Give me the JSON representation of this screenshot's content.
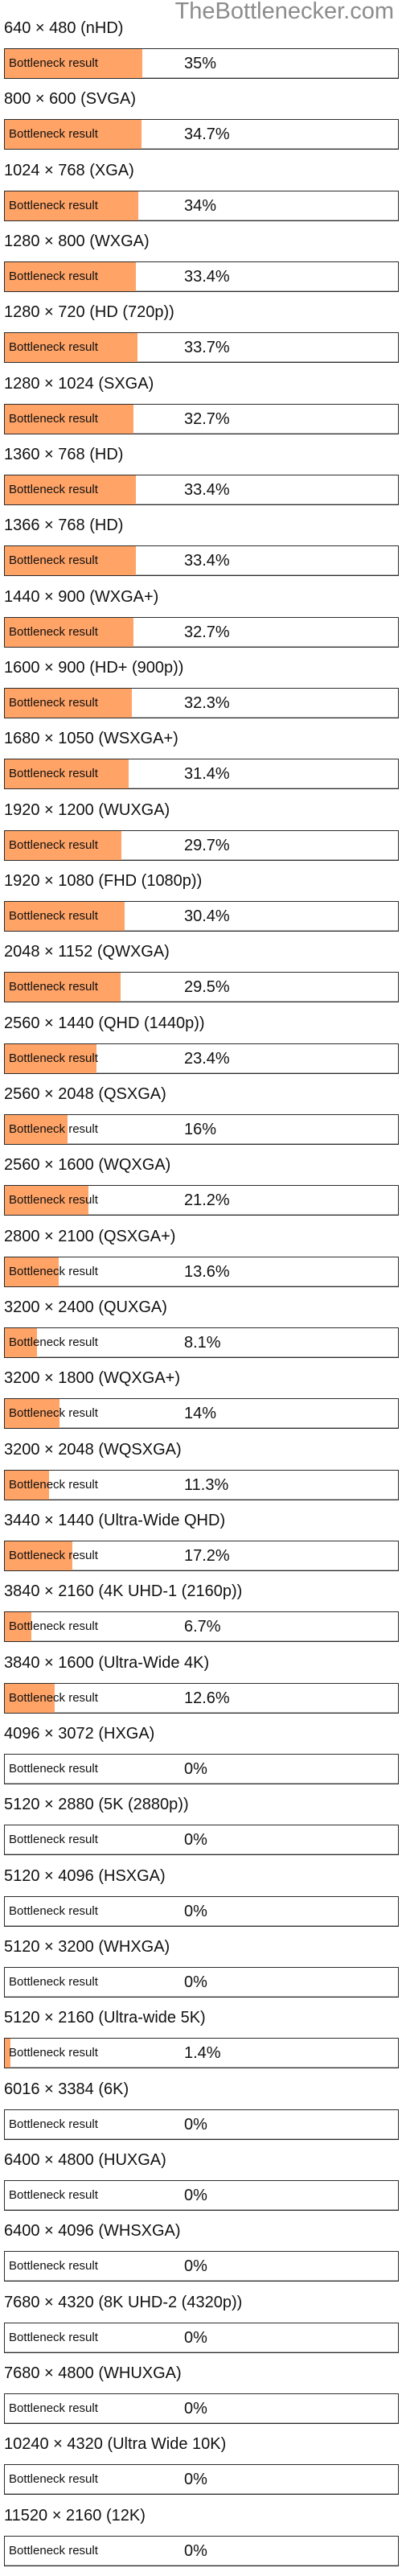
{
  "site": {
    "watermark": "TheBottlenecker.com"
  },
  "theme": {
    "fill_color": "#ffa366",
    "border_color": "#2b2b2b"
  },
  "chart_data": {
    "type": "bar",
    "orientation": "horizontal",
    "title": "",
    "xlabel": "",
    "ylabel": "",
    "xlim": [
      0,
      100
    ],
    "bar_label": "Bottleneck result",
    "series": [
      {
        "name": "Bottleneck result",
        "unit": "%"
      }
    ],
    "rows": [
      {
        "resolution": "640 × 480 (nHD)",
        "value": 35,
        "display": "35%"
      },
      {
        "resolution": "800 × 600 (SVGA)",
        "value": 34.7,
        "display": "34.7%"
      },
      {
        "resolution": "1024 × 768 (XGA)",
        "value": 34,
        "display": "34%"
      },
      {
        "resolution": "1280 × 800 (WXGA)",
        "value": 33.4,
        "display": "33.4%"
      },
      {
        "resolution": "1280 × 720 (HD (720p))",
        "value": 33.7,
        "display": "33.7%"
      },
      {
        "resolution": "1280 × 1024 (SXGA)",
        "value": 32.7,
        "display": "32.7%"
      },
      {
        "resolution": "1360 × 768 (HD)",
        "value": 33.4,
        "display": "33.4%"
      },
      {
        "resolution": "1366 × 768 (HD)",
        "value": 33.4,
        "display": "33.4%"
      },
      {
        "resolution": "1440 × 900 (WXGA+)",
        "value": 32.7,
        "display": "32.7%"
      },
      {
        "resolution": "1600 × 900 (HD+ (900p))",
        "value": 32.3,
        "display": "32.3%"
      },
      {
        "resolution": "1680 × 1050 (WSXGA+)",
        "value": 31.4,
        "display": "31.4%"
      },
      {
        "resolution": "1920 × 1200 (WUXGA)",
        "value": 29.7,
        "display": "29.7%"
      },
      {
        "resolution": "1920 × 1080 (FHD (1080p))",
        "value": 30.4,
        "display": "30.4%"
      },
      {
        "resolution": "2048 × 1152 (QWXGA)",
        "value": 29.5,
        "display": "29.5%"
      },
      {
        "resolution": "2560 × 1440 (QHD (1440p))",
        "value": 23.4,
        "display": "23.4%"
      },
      {
        "resolution": "2560 × 2048 (QSXGA)",
        "value": 16,
        "display": "16%"
      },
      {
        "resolution": "2560 × 1600 (WQXGA)",
        "value": 21.2,
        "display": "21.2%"
      },
      {
        "resolution": "2800 × 2100 (QSXGA+)",
        "value": 13.6,
        "display": "13.6%"
      },
      {
        "resolution": "3200 × 2400 (QUXGA)",
        "value": 8.1,
        "display": "8.1%"
      },
      {
        "resolution": "3200 × 1800 (WQXGA+)",
        "value": 14,
        "display": "14%"
      },
      {
        "resolution": "3200 × 2048 (WQSXGA)",
        "value": 11.3,
        "display": "11.3%"
      },
      {
        "resolution": "3440 × 1440 (Ultra-Wide QHD)",
        "value": 17.2,
        "display": "17.2%"
      },
      {
        "resolution": "3840 × 2160 (4K UHD-1 (2160p))",
        "value": 6.7,
        "display": "6.7%"
      },
      {
        "resolution": "3840 × 1600 (Ultra-Wide 4K)",
        "value": 12.6,
        "display": "12.6%"
      },
      {
        "resolution": "4096 × 3072 (HXGA)",
        "value": 0,
        "display": "0%"
      },
      {
        "resolution": "5120 × 2880 (5K (2880p))",
        "value": 0,
        "display": "0%"
      },
      {
        "resolution": "5120 × 4096 (HSXGA)",
        "value": 0,
        "display": "0%"
      },
      {
        "resolution": "5120 × 3200 (WHXGA)",
        "value": 0,
        "display": "0%"
      },
      {
        "resolution": "5120 × 2160 (Ultra-wide 5K)",
        "value": 1.4,
        "display": "1.4%"
      },
      {
        "resolution": "6016 × 3384 (6K)",
        "value": 0,
        "display": "0%"
      },
      {
        "resolution": "6400 × 4800 (HUXGA)",
        "value": 0,
        "display": "0%"
      },
      {
        "resolution": "6400 × 4096 (WHSXGA)",
        "value": 0,
        "display": "0%"
      },
      {
        "resolution": "7680 × 4320 (8K UHD-2 (4320p))",
        "value": 0,
        "display": "0%"
      },
      {
        "resolution": "7680 × 4800 (WHUXGA)",
        "value": 0,
        "display": "0%"
      },
      {
        "resolution": "10240 × 4320 (Ultra Wide 10K)",
        "value": 0,
        "display": "0%"
      },
      {
        "resolution": "11520 × 2160 (12K)",
        "value": 0,
        "display": "0%"
      }
    ]
  }
}
